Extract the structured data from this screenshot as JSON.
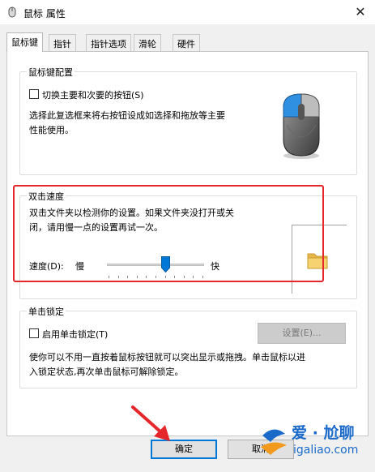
{
  "window": {
    "title": "鼠标 属性",
    "close_glyph": "✕"
  },
  "tabs": [
    {
      "label": "鼠标键",
      "active": true
    },
    {
      "label": "指针",
      "active": false
    },
    {
      "label": "指针选项",
      "active": false
    },
    {
      "label": "滑轮",
      "active": false
    },
    {
      "label": "硬件",
      "active": false
    }
  ],
  "button_config": {
    "group_label": "鼠标键配置",
    "switch_checkbox_label": "切换主要和次要的按钮(S)",
    "switch_checked": false,
    "description_line1": "选择此复选框来将右按钮设成如选择和拖放等主要",
    "description_line2": "性能使用。"
  },
  "double_click": {
    "group_label": "双击速度",
    "description_line1": "双击文件夹以检测你的设置。如果文件夹没打开或关",
    "description_line2": "闭，请用慢一点的设置再试一次。",
    "speed_label": "速度(D):",
    "slow_label": "慢",
    "fast_label": "快",
    "speed_level_fraction": 0.6
  },
  "click_lock": {
    "group_label": "单击锁定",
    "checkbox_label": "启用单击锁定(T)",
    "checked": false,
    "settings_button": "设置(E)...",
    "description_line1": "使你可以不用一直按着鼠标按钮就可以突出显示或拖拽。单击鼠标以进",
    "description_line2": "入锁定状态,再次单击鼠标可解除锁定。"
  },
  "footer": {
    "ok_button": "确定",
    "cancel_button": "取消"
  },
  "watermark": {
    "brand": "爱 · 尬聊",
    "url": "igaliao.com"
  },
  "colors": {
    "accent": "#0078d7",
    "highlight_box": "#e5262b",
    "arrow": "#e5262b"
  }
}
